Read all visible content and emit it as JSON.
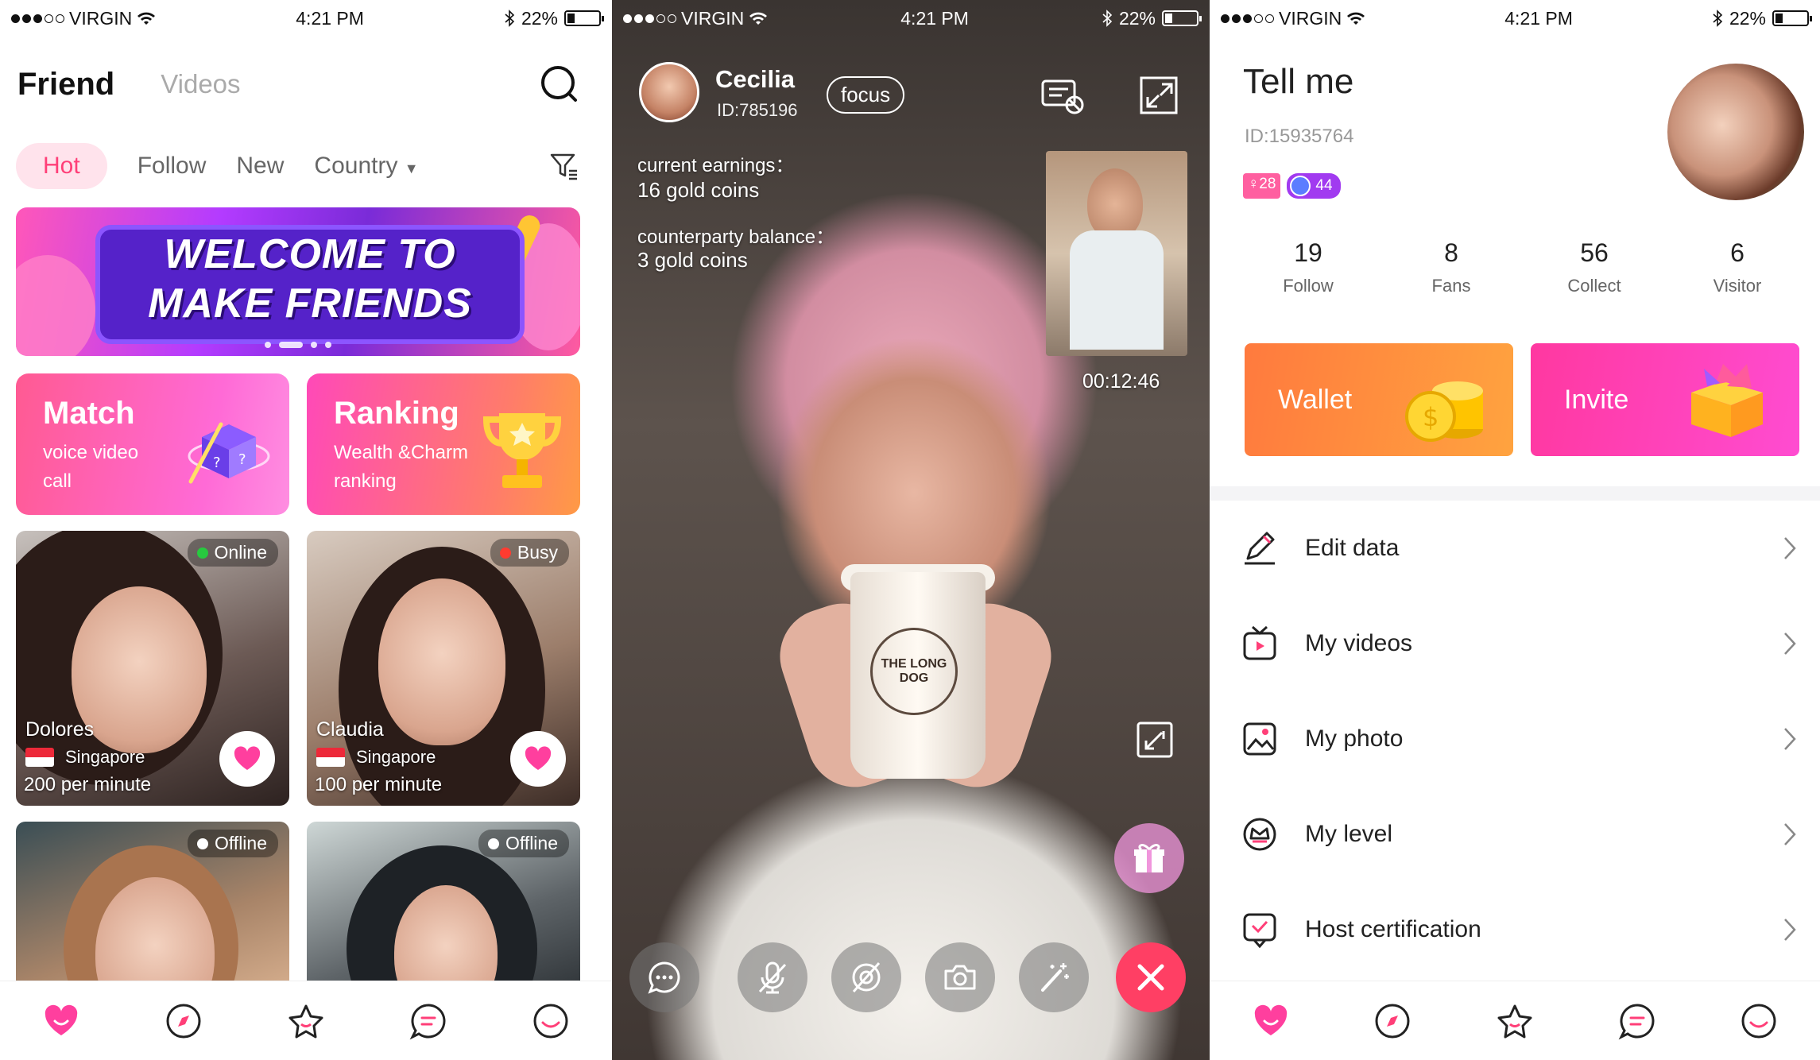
{
  "status": {
    "carrier": "VIRGIN",
    "time": "4:21 PM",
    "battery": "22%"
  },
  "friend": {
    "title": "Friend",
    "tab_videos": "Videos",
    "filters": [
      "Hot",
      "Follow",
      "New",
      "Country"
    ],
    "banner_line1": "WELCOME TO",
    "banner_line2": "MAKE FRIENDS",
    "match": {
      "title": "Match",
      "desc": "voice video call"
    },
    "ranking": {
      "title": "Ranking",
      "desc": "Wealth &Charm ranking"
    },
    "users": [
      {
        "status": "Online",
        "status_color": "#27c93f",
        "name": "Dolores",
        "country": "Singapore",
        "price": "200 per minute"
      },
      {
        "status": "Busy",
        "status_color": "#ff3b30",
        "name": "Claudia",
        "country": "Singapore",
        "price": "100 per minute"
      },
      {
        "status": "Offline",
        "status_color": "#ffffff"
      },
      {
        "status": "Offline",
        "status_color": "#ffffff"
      }
    ]
  },
  "call": {
    "name": "Cecilia",
    "id": "ID:785196",
    "focus": "focus",
    "earnings_label": "current earnings：",
    "earnings_value": "16 gold coins",
    "balance_label": "counterparty balance：",
    "balance_value": "3 gold coins",
    "timer": "00:12:46",
    "cup_text": "THE LONG DOG"
  },
  "profile": {
    "name": "Tell me",
    "id": "ID:15935764",
    "badge_age": "♀28",
    "badge_level": "44",
    "stats": [
      {
        "n": "19",
        "l": "Follow"
      },
      {
        "n": "8",
        "l": "Fans"
      },
      {
        "n": "56",
        "l": "Collect"
      },
      {
        "n": "6",
        "l": "Visitor"
      }
    ],
    "wallet": "Wallet",
    "invite": "Invite",
    "menu": [
      "Edit data",
      "My videos",
      "My photo",
      "My level",
      "Host certification"
    ]
  },
  "colors": {
    "accent": "#ff3f78",
    "pink": "#ff4cd1",
    "orange": "#ff8a3e"
  }
}
